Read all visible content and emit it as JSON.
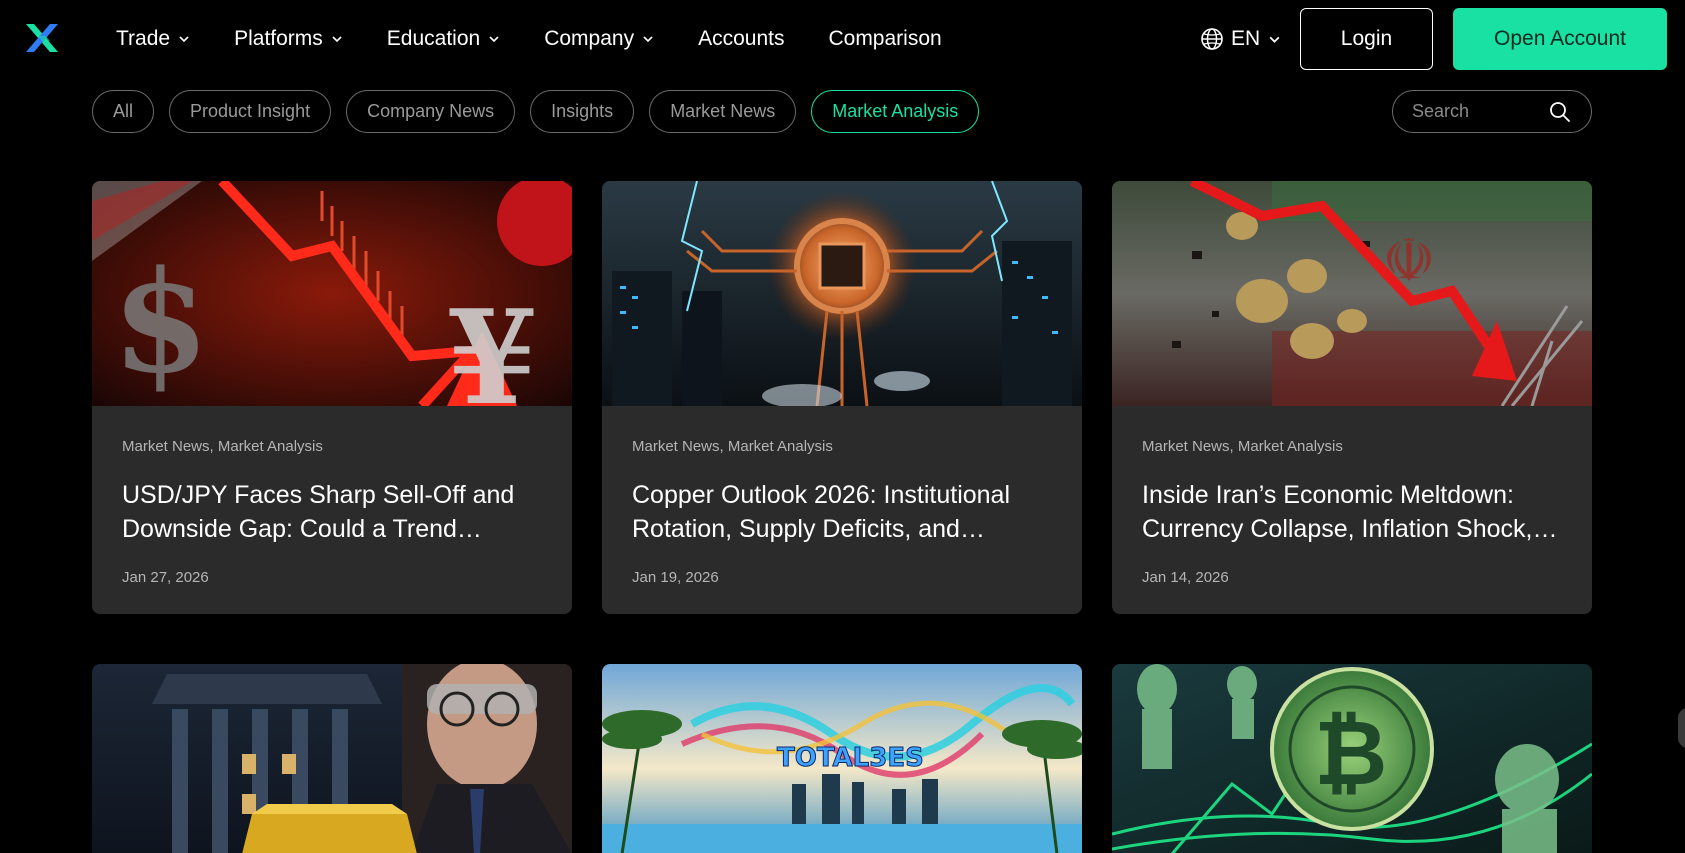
{
  "nav": {
    "logo_icon": "x-logo-icon",
    "items": [
      {
        "label": "Trade",
        "has_dropdown": true
      },
      {
        "label": "Platforms",
        "has_dropdown": true
      },
      {
        "label": "Education",
        "has_dropdown": true
      },
      {
        "label": "Company",
        "has_dropdown": true
      },
      {
        "label": "Accounts",
        "has_dropdown": false
      },
      {
        "label": "Comparison",
        "has_dropdown": false
      }
    ],
    "language": "EN",
    "login_label": "Login",
    "open_account_label": "Open Account"
  },
  "filters": {
    "pills": [
      "All",
      "Product Insight",
      "Company News",
      "Insights",
      "Market News",
      "Market Analysis"
    ],
    "active": "Market Analysis",
    "search_placeholder": "Search"
  },
  "colors": {
    "accent": "#19e0a3",
    "card_bg": "#2b2b2b",
    "page_bg": "#000000"
  },
  "articles": [
    {
      "categories": "Market News, Market Analysis",
      "title": "USD/JPY Faces Sharp Sell-Off and Downside Gap: Could a Trend…",
      "date": "Jan 27, 2026"
    },
    {
      "categories": "Market News, Market Analysis",
      "title": "Copper Outlook 2026: Institutional Rotation, Supply Deficits, and…",
      "date": "Jan 19, 2026"
    },
    {
      "categories": "Market News, Market Analysis",
      "title": "Inside Iran’s Economic Meltdown: Currency Collapse, Inflation Shock,…",
      "date": "Jan 14, 2026"
    }
  ],
  "second_row_thumbnail_text": "TOTAL3ES"
}
